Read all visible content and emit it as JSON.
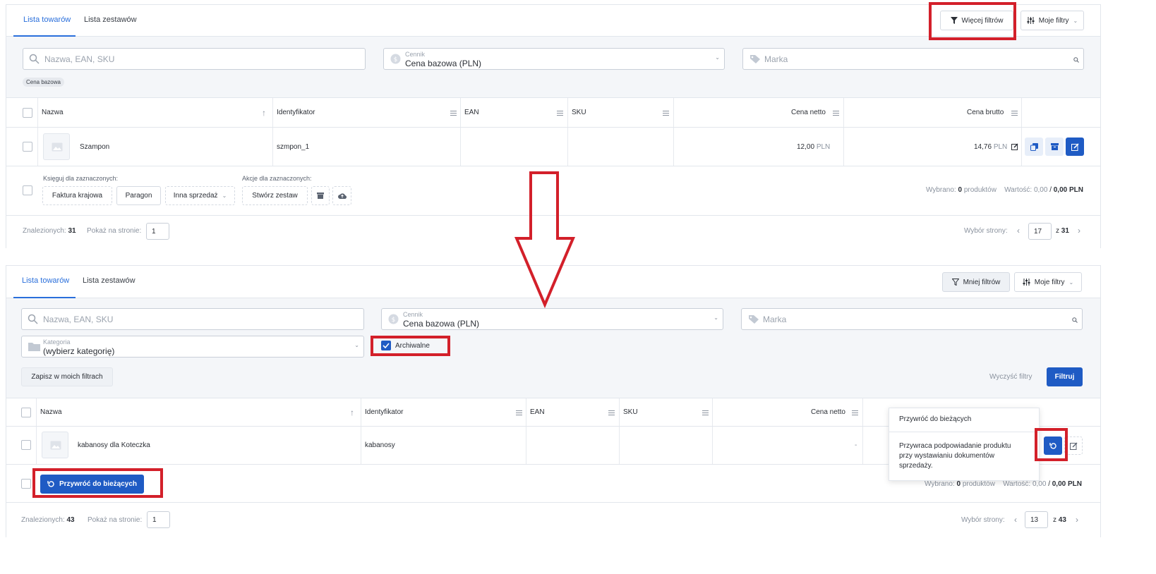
{
  "top": {
    "tabs": [
      {
        "label": "Lista towarów"
      },
      {
        "label": "Lista zestawów"
      }
    ],
    "more_filters": "Więcej filtrów",
    "my_filters": "Moje filtry",
    "search_placeholder": "Nazwa, EAN, SKU",
    "pricelist_label": "Cennik",
    "pricelist_value": "Cena bazowa (PLN)",
    "brand_placeholder": "Marka",
    "chip": "Cena bazowa",
    "columns": {
      "name": "Nazwa",
      "identifier": "Identyfikator",
      "ean": "EAN",
      "sku": "SKU",
      "net": "Cena netto",
      "gross": "Cena brutto"
    },
    "row": {
      "name": "Szampon",
      "identifier": "szmpon_1",
      "net_value": "12,00",
      "net_currency": "PLN",
      "gross_value": "14,76",
      "gross_currency": "PLN"
    },
    "bulk": {
      "post_label": "Księguj dla zaznaczonych:",
      "invoice": "Faktura krajowa",
      "receipt": "Paragon",
      "other_sale": "Inna sprzedaż",
      "actions_label": "Akcje dla zaznaczonych:",
      "create_set": "Stwórz zestaw",
      "selected_label": "Wybrano:",
      "selected_count": "0",
      "selected_unit": "produktów",
      "value_label": "Wartość:",
      "value_net": "0,00",
      "value_sep": "/",
      "value_gross": "0,00 PLN"
    },
    "footer": {
      "found_label": "Znalezionych:",
      "found_count": "31",
      "per_page_label": "Pokaż na stronie:",
      "per_page_value": "1",
      "page_label": "Wybór strony:",
      "page_value": "17",
      "of_label": "z",
      "page_total": "31"
    }
  },
  "bottom": {
    "tabs": [
      {
        "label": "Lista towarów"
      },
      {
        "label": "Lista zestawów"
      }
    ],
    "less_filters": "Mniej filtrów",
    "my_filters": "Moje filtry",
    "search_placeholder": "Nazwa, EAN, SKU",
    "pricelist_label": "Cennik",
    "pricelist_value": "Cena bazowa (PLN)",
    "brand_placeholder": "Marka",
    "category_label": "Kategoria",
    "category_value": "(wybierz kategorię)",
    "archived_label": "Archiwalne",
    "save_filters": "Zapisz w moich filtrach",
    "clear_filters": "Wyczyść filtry",
    "filter": "Filtruj",
    "columns": {
      "name": "Nazwa",
      "identifier": "Identyfikator",
      "ean": "EAN",
      "sku": "SKU",
      "net": "Cena netto"
    },
    "row": {
      "name": "kabanosy dla Koteczka",
      "identifier": "kabanosy",
      "net_value": "-"
    },
    "restore_button": "Przywróć do bieżących",
    "bulk": {
      "selected_label": "Wybrano:",
      "selected_count": "0",
      "selected_unit": "produktów",
      "value_label": "Wartość:",
      "value_net": "0,00",
      "value_sep": "/",
      "value_gross": "0,00 PLN"
    },
    "tooltip": {
      "title": "Przywróć do bieżących",
      "text": "Przywraca podpowiadanie produktu przy wystawianiu dokumentów sprzedaży."
    },
    "footer": {
      "found_label": "Znalezionych:",
      "found_count": "43",
      "per_page_label": "Pokaż na stronie:",
      "per_page_value": "1",
      "page_label": "Wybór strony:",
      "page_value": "13",
      "of_label": "z",
      "page_total": "43"
    }
  },
  "colors": {
    "accent": "#1f5bc4",
    "highlight": "#d3202a"
  }
}
